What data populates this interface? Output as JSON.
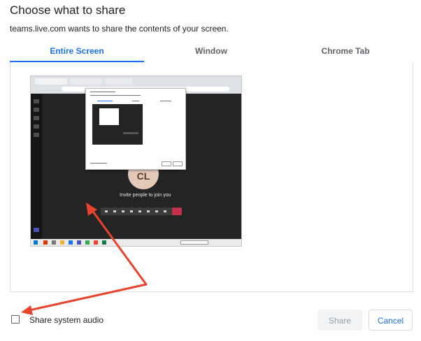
{
  "dialog": {
    "title": "Choose what to share",
    "subtitle": "teams.live.com wants to share the contents of your screen."
  },
  "tabs": [
    {
      "label": "Entire Screen",
      "active": true
    },
    {
      "label": "Window",
      "active": false
    },
    {
      "label": "Chrome Tab",
      "active": false
    }
  ],
  "preview": {
    "avatar_initials": "CL",
    "invite_text": "Invite people to join you"
  },
  "audio": {
    "label": "Share system audio",
    "checked": false
  },
  "buttons": {
    "share_label": "Share",
    "share_enabled": false,
    "cancel_label": "Cancel"
  },
  "colors": {
    "accent": "#1a73e8",
    "annotation_arrow": "#e8432c",
    "hangup": "#c4314b"
  }
}
